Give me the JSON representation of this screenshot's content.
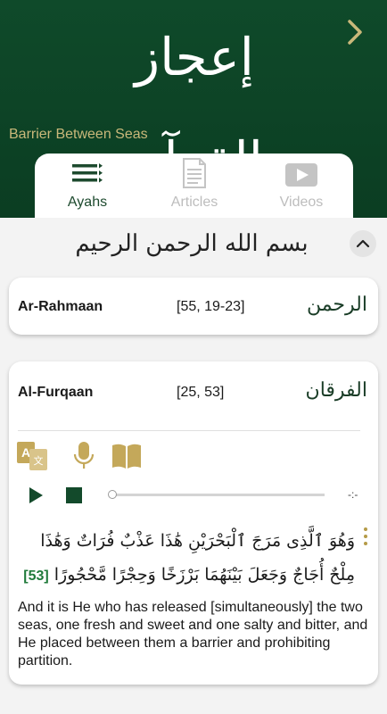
{
  "header": {
    "logo_text": "إعجاز القرآن",
    "subtitle": "Barrier Between Seas",
    "next_icon": "chevron-right-icon"
  },
  "tabs": [
    {
      "label": "Ayahs",
      "icon": "list-icon",
      "active": true
    },
    {
      "label": "Articles",
      "icon": "document-icon",
      "active": false
    },
    {
      "label": "Videos",
      "icon": "video-icon",
      "active": false
    }
  ],
  "basmala": "بسم الله الرحمن الرحيم",
  "cards": [
    {
      "surah": "Ar-Rahmaan",
      "ref": "[55, 19-23]",
      "arabic_name": "الرحمن"
    },
    {
      "surah": "Al-Furqaan",
      "ref": "[25, 53]",
      "arabic_name": "الفرقان",
      "player": {
        "time": "-:-",
        "progress": 0
      },
      "ayah_arabic": "وَهُوَ ٱلَّذِى مَرَجَ ٱلْبَحْرَيْنِ هَٰذَا عَذْبٌ فُرَاتٌ وَهَٰذَا مِلْحٌ أُجَاجٌ وَجَعَلَ بَيْنَهُمَا بَرْزَخًا وَحِجْرًا مَّحْجُورًا",
      "ayah_number": "[53]",
      "translation": "And it is He who has released [simultaneously] the two seas, one fresh and sweet and one salty and bitter, and He placed between them a barrier and prohibiting partition."
    }
  ],
  "colors": {
    "header": "#0f4a2a",
    "accent": "#b59b48",
    "ayah_number": "#1f7a3a",
    "active_tab": "#1d4a2e"
  }
}
